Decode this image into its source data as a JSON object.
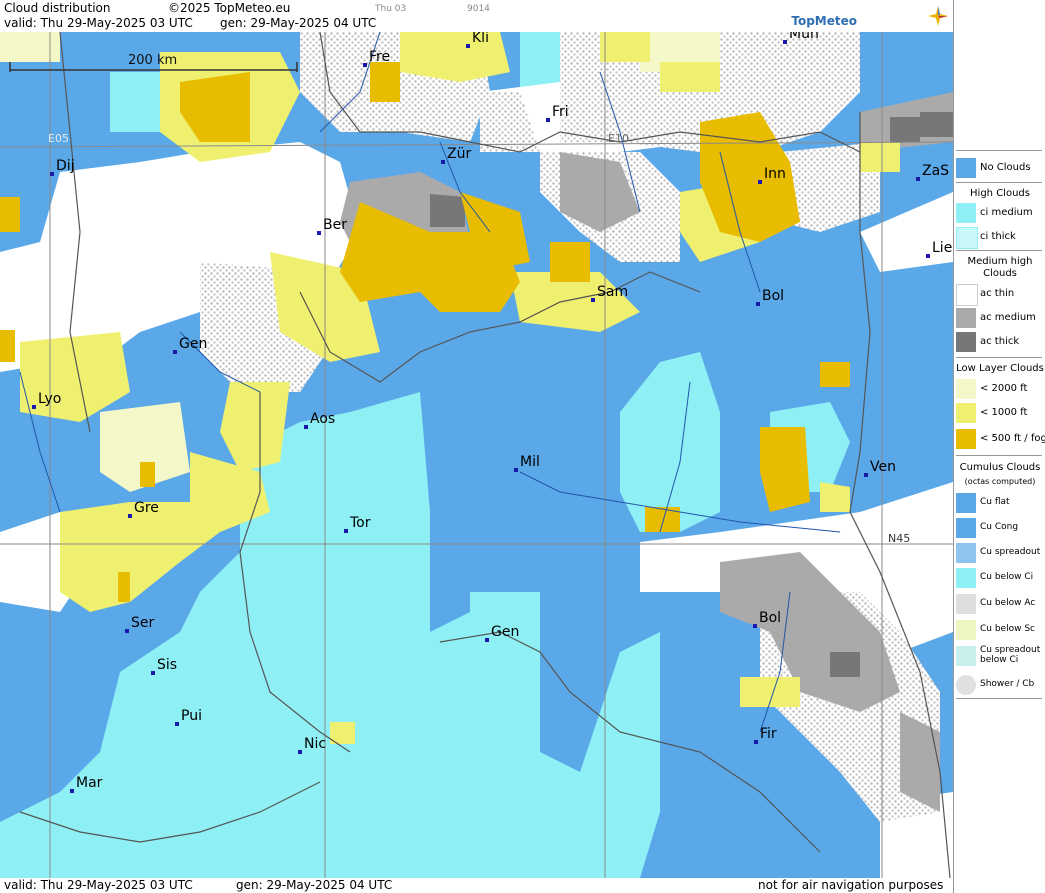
{
  "header": {
    "title": "Cloud distribution",
    "copyright": "©2025 TopMeteo.eu",
    "small_time": "Thu 03",
    "small_code": "9014",
    "valid": "valid:  Thu  29-May-2025  03 UTC",
    "gen": "gen: 29-May-2025 04 UTC",
    "logo": "TopMeteo"
  },
  "footer": {
    "valid": "valid:  Thu  29-May-2025  03 UTC",
    "gen": "gen: 29-May-2025 04 UTC",
    "disclaimer": "not for air navigation purposes"
  },
  "map": {
    "scale_label": "200 km",
    "grid_labels": {
      "e05": "E05",
      "e10": "E10",
      "n45": "N45"
    },
    "cities": [
      "Kli",
      "Mun",
      "Fre",
      "Fri",
      "Dij",
      "Zür",
      "Inn",
      "ZaS",
      "Ber",
      "Lie",
      "Sam",
      "Bol",
      "Gen",
      "Lyo",
      "Aos",
      "Mil",
      "Ven",
      "Gre",
      "Tor",
      "Ser",
      "Gen",
      "Bol",
      "Sis",
      "Pui",
      "Nic",
      "Fir",
      "Mar"
    ]
  },
  "legend": {
    "no_clouds": "No Clouds",
    "high_title": "High Clouds",
    "ci_medium": "ci medium",
    "ci_thick": "ci thick",
    "medium_title": "Medium high Clouds",
    "ac_thin": "ac thin",
    "ac_medium": "ac medium",
    "ac_thick": "ac thick",
    "low_title": "Low Layer Clouds",
    "low_2000": "< 2000 ft",
    "low_1000": "< 1000 ft",
    "low_500": "< 500 ft / fog",
    "cu_title": "Cumulus Clouds",
    "cu_sub": "(octas computed)",
    "cu_flat": "Cu flat",
    "cu_cong": "Cu Cong",
    "cu_spreadout": "Cu spreadout",
    "cu_below_ci": "Cu below Ci",
    "cu_below_ac": "Cu below Ac",
    "cu_below_sc": "Cu below Sc",
    "cu_spreadout_below_ci": "Cu spreadout below Ci",
    "shower": "Shower / Cb"
  },
  "colors": {
    "no_clouds": "#5aa8e8",
    "ci_medium": "#8ef0f4",
    "ci_thick": "#c8f8f8",
    "ac_thin": "#ffffff",
    "ac_medium": "#aaaaaa",
    "ac_thick": "#777777",
    "low_2000": "#f4f8c8",
    "low_1000": "#f0f070",
    "low_500": "#e8bc00"
  }
}
